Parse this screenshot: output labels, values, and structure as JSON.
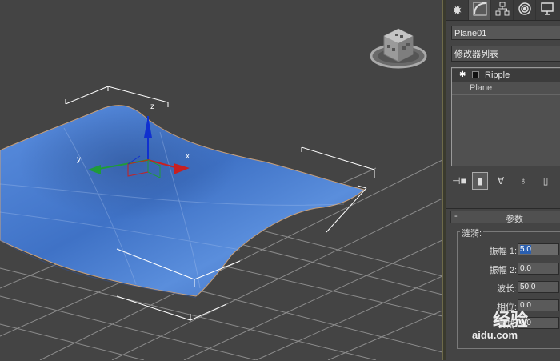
{
  "viewport": {
    "gizmo_labels": {
      "x": "x",
      "y": "y",
      "z": "z"
    },
    "colors": {
      "plane": "#4a7fd0",
      "grid": "#9a9a9a",
      "axis_x": "#c82020",
      "axis_y": "#1f9a3a",
      "axis_z": "#1030d0"
    }
  },
  "panel": {
    "tabs": [
      {
        "icon": "sun-icon"
      },
      {
        "icon": "modify-icon"
      },
      {
        "icon": "hierarchy-icon"
      },
      {
        "icon": "motion-icon"
      },
      {
        "icon": "display-icon"
      }
    ],
    "object_name": "Plane01",
    "modifier_list": "修改器列表",
    "stack": [
      {
        "label": "Ripple",
        "type": "modifier"
      },
      {
        "label": "Plane",
        "type": "base"
      }
    ],
    "rollout": {
      "collapse_symbol": "-",
      "title": "参数",
      "group_title": "涟漪:",
      "params": [
        {
          "label": "振幅 1:",
          "value": "5.0"
        },
        {
          "label": "振幅 2:",
          "value": "0.0"
        },
        {
          "label": "波长:",
          "value": "50.0"
        },
        {
          "label": "相位:",
          "value": "0.0"
        },
        {
          "label": "衰减:",
          "value": "0.0"
        }
      ]
    }
  },
  "watermark": {
    "main": "经验",
    "sub": "aidu.com"
  }
}
